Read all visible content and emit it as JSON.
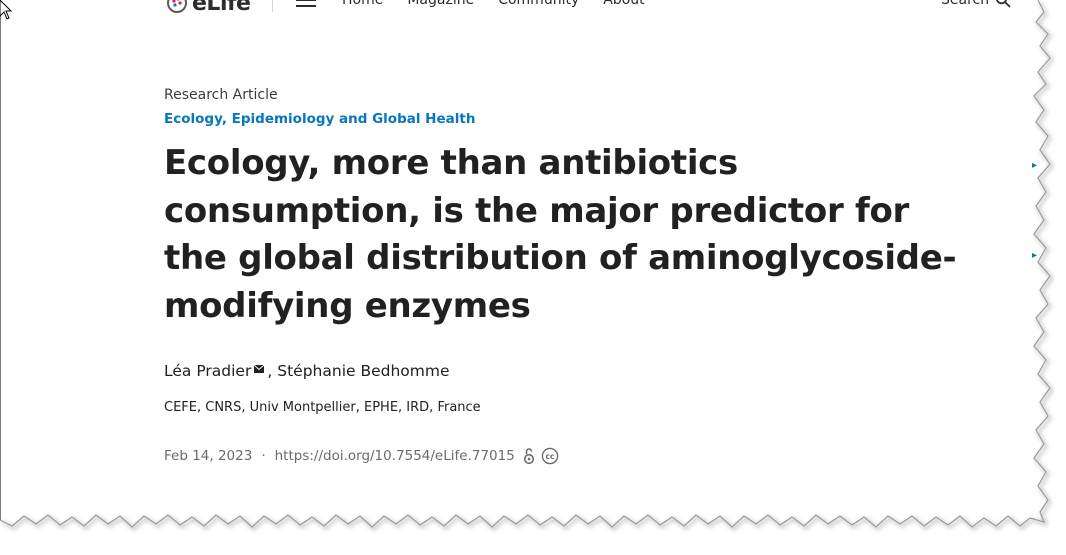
{
  "nav": {
    "logo_text": "eLife",
    "links": [
      "Home",
      "Magazine",
      "Community",
      "About"
    ],
    "search_label": "Search"
  },
  "article": {
    "type": "Research Article",
    "subject": "Ecology, Epidemiology and Global Health",
    "title": "Ecology, more than antibiotics consumption, is the major predictor for the global distribution of aminoglycoside-modifying enzymes",
    "authors": [
      {
        "name": "Léa Pradier",
        "has_email": true
      },
      {
        "name": "Stéphanie Bedhomme",
        "has_email": false
      }
    ],
    "author_separator": ",",
    "affiliation": "CEFE, CNRS, Univ Montpellier, EPHE, IRD, France",
    "date": "Feb 14, 2023",
    "separator": "·",
    "doi": "https://doi.org/10.7554/eLife.77015"
  },
  "icons": {
    "logo": "elife-logo-icon",
    "menu": "hamburger-menu-icon",
    "search": "search-icon",
    "email": "email-icon",
    "open_access": "open-access-icon",
    "license": "creative-commons-icon",
    "cursor": "mouse-cursor-icon"
  },
  "colors": {
    "link_blue": "#0877bd",
    "text": "#212121",
    "muted": "#6b6b6b"
  }
}
